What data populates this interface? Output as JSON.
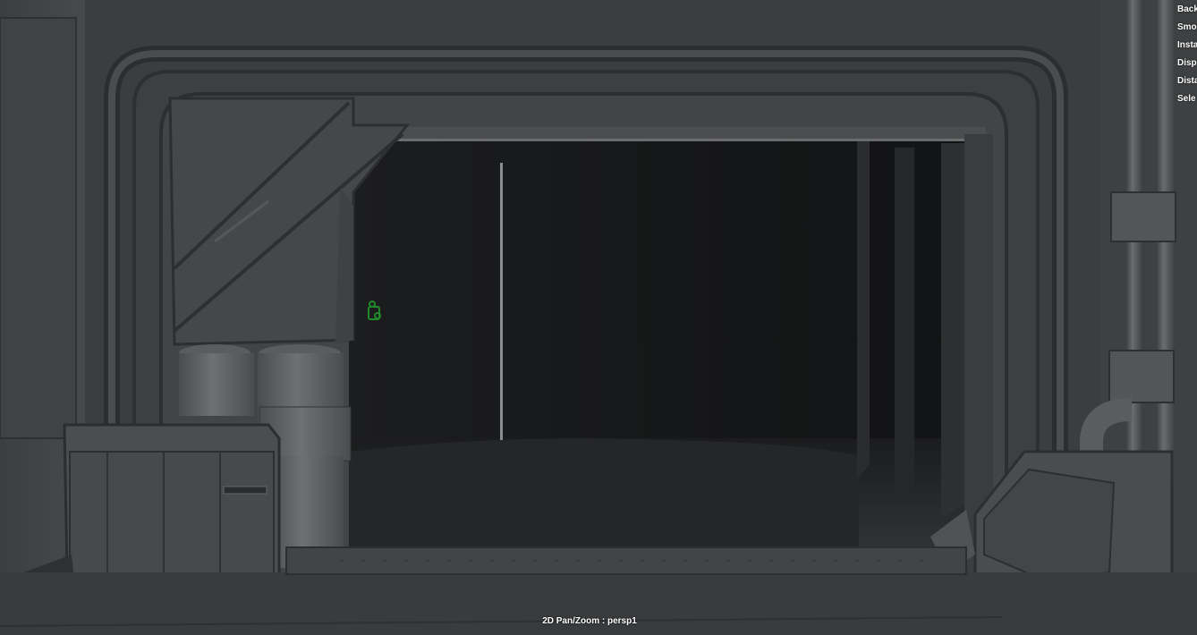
{
  "viewport": {
    "hud_menu": [
      {
        "label": "Back"
      },
      {
        "label": "Smo"
      },
      {
        "label": "Insta"
      },
      {
        "label": "Disp"
      },
      {
        "label": "Dista"
      },
      {
        "label": "Sele"
      }
    ],
    "status_text": "2D Pan/Zoom : persp1"
  },
  "colors": {
    "background": "#3a3c3e",
    "hud_text": "#ffffff",
    "camera_marker": "#1f8a2a"
  },
  "icons": [
    "camera-icon"
  ]
}
